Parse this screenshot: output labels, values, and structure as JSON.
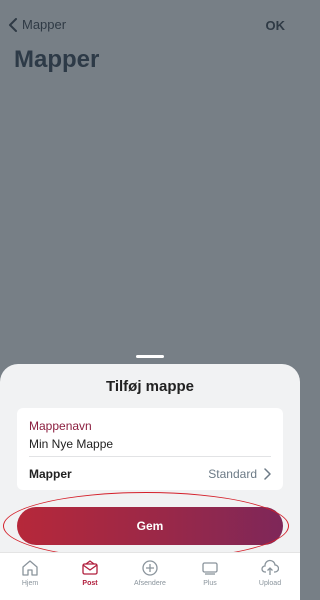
{
  "nav": {
    "back_label": "Mapper",
    "ok_label": "OK"
  },
  "page": {
    "title": "Mapper"
  },
  "sheet": {
    "title": "Tilføj mappe",
    "name_label": "Mappenavn",
    "name_value": "Min Nye Mappe",
    "folder_label": "Mapper",
    "folder_value": "Standard",
    "save_label": "Gem"
  },
  "tabs": [
    {
      "label": "Hjem",
      "icon": "home-icon"
    },
    {
      "label": "Post",
      "icon": "mail-icon",
      "active": true
    },
    {
      "label": "Afsendere",
      "icon": "plus-circle-icon"
    },
    {
      "label": "Plus",
      "icon": "plus-box-icon"
    },
    {
      "label": "Upload",
      "icon": "cloud-upload-icon"
    }
  ],
  "colors": {
    "accent": "#b01e3c",
    "overlay": "#777f86",
    "button_start": "#b6283a",
    "button_end": "#7e2759"
  }
}
